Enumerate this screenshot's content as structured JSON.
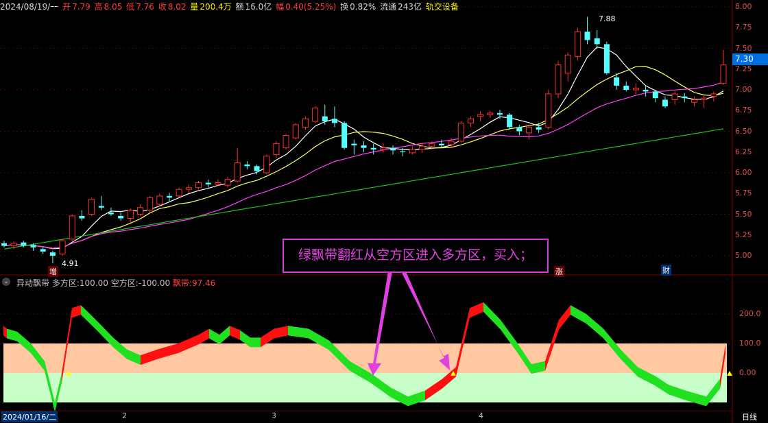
{
  "header": {
    "date": "2024/08/19/一",
    "open_label": "开",
    "open": "7.79",
    "high_label": "高",
    "high": "8.05",
    "low_label": "低",
    "low": "7.76",
    "close_label": "收",
    "close": "8.02",
    "vol_label": "量",
    "vol": "200.4万",
    "amt_label": "额",
    "amt": "16.0亿",
    "amp_label": "幅",
    "amp": "0.40(5.25%)",
    "turn_label": "换",
    "turn": "0.82%",
    "float_label": "流通",
    "float": "243亿",
    "sector": "轨交设备"
  },
  "price_axis": [
    "8.00",
    "7.75",
    "7.50",
    "7.25",
    "7.00",
    "6.75",
    "6.50",
    "6.25",
    "6.00",
    "5.75",
    "5.50",
    "5.25",
    "5.00"
  ],
  "current_price": "7.30",
  "high_marker": "7.88",
  "low_marker": "4.91",
  "event_marks": {
    "zeng": "增",
    "zhang": "涨",
    "cai": "财"
  },
  "annotation": "绿飘带翻红从空方区进入多方区，买入；",
  "indicator": {
    "name": "异动飘带",
    "long_label": "多方区:",
    "long_value": "100.00",
    "short_label": "空方区:",
    "short_value": "-100.00",
    "band_label": "飘带:",
    "band_value": "97.46",
    "axis": [
      "200.0",
      "100.0",
      "0.00"
    ]
  },
  "date_axis": {
    "start": "2024/01/16/二",
    "months": [
      "2",
      "3",
      "4"
    ],
    "period": "日线"
  },
  "colors": {
    "up": "#ff3030",
    "down": "#54ffff",
    "ma5": "#ffffff",
    "ma10": "#ffff60",
    "ma20": "#ff40ff",
    "ma60": "#20c020",
    "long_zone": "#ffc8a0",
    "short_zone": "#c8ffc8"
  }
}
